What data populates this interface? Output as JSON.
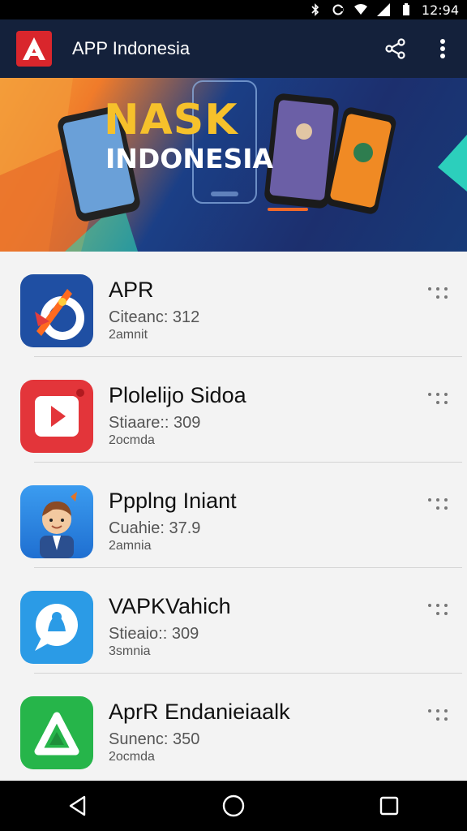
{
  "status_bar": {
    "time": "12:94"
  },
  "app_bar": {
    "title": "APP Indonesia"
  },
  "banner": {
    "title": "NASK",
    "subtitle": "INDONESIA"
  },
  "apps": [
    {
      "name": "APR",
      "meta": "Citeanc: 312",
      "sub": "2amnit",
      "icon": "colorful-arrow-app-icon"
    },
    {
      "name": "Plolelijo Sidoa",
      "meta": "Stiaare:: 309",
      "sub": "2ocmda",
      "icon": "video-play-app-icon"
    },
    {
      "name": "Ppplng Iniant",
      "meta": "Cuahie: 37.9",
      "sub": "2amnia",
      "icon": "cartoon-avatar-app-icon"
    },
    {
      "name": "VAPKVahich",
      "meta": "Stieaio:: 309",
      "sub": "3smnia",
      "icon": "chat-bubble-app-icon"
    },
    {
      "name": "AprR Endanieiaalk",
      "meta": "Sunenc: 350",
      "sub": "2ocmda",
      "icon": "green-triangle-app-icon"
    }
  ],
  "colors": {
    "app_bar": "#14213b",
    "accent": "#d9262c",
    "banner_title": "#f6c12b"
  }
}
